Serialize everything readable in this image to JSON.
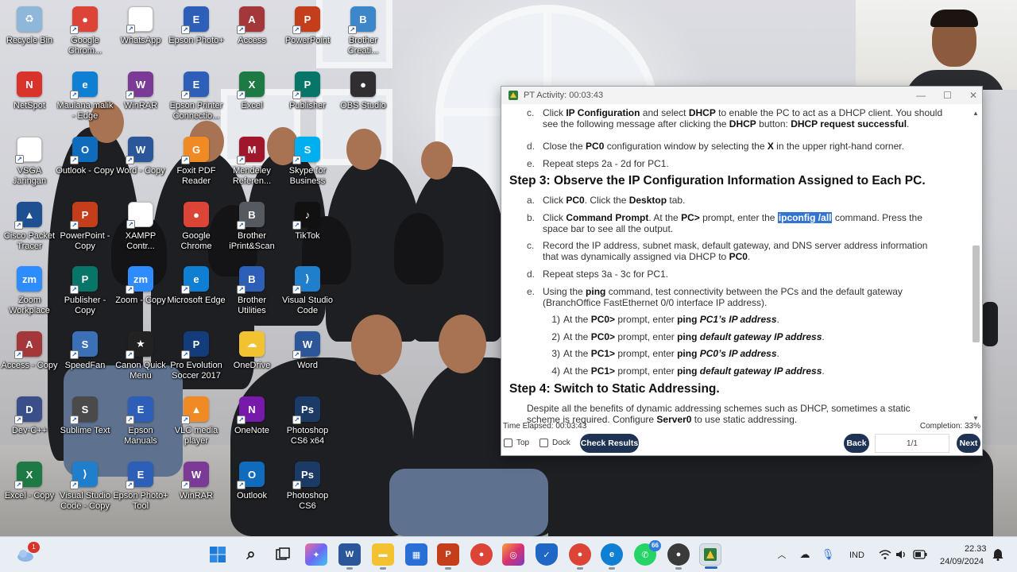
{
  "desktop_icons": [
    {
      "label": "Recycle Bin",
      "color": "#8fb7d9",
      "glyph": "♻",
      "shortcut": false
    },
    {
      "label": "Google Chrom...",
      "color": "#db4437",
      "glyph": "●",
      "shortcut": true
    },
    {
      "label": "WhatsApp",
      "color": "#ffffff",
      "glyph": "",
      "shortcut": true
    },
    {
      "label": "Epson Photo+",
      "color": "#2d5fb8",
      "glyph": "E",
      "shortcut": true
    },
    {
      "label": "Access",
      "color": "#a4373a",
      "glyph": "A",
      "shortcut": true
    },
    {
      "label": "PowerPoint",
      "color": "#c43e1c",
      "glyph": "P",
      "shortcut": true
    },
    {
      "label": "Brother Creati...",
      "color": "#3d86c9",
      "glyph": "B",
      "shortcut": true
    },
    {
      "label": "NetSpot",
      "color": "#d9342b",
      "glyph": "N",
      "shortcut": false
    },
    {
      "label": "Maulana malik - Edge",
      "color": "#0f7fd4",
      "glyph": "e",
      "shortcut": true
    },
    {
      "label": "WinRAR",
      "color": "#7b3a96",
      "glyph": "W",
      "shortcut": true
    },
    {
      "label": "Epson Printer Connectio...",
      "color": "#2d5fb8",
      "glyph": "E",
      "shortcut": true
    },
    {
      "label": "Excel",
      "color": "#1d7a45",
      "glyph": "X",
      "shortcut": true
    },
    {
      "label": "Publisher",
      "color": "#077568",
      "glyph": "P",
      "shortcut": true
    },
    {
      "label": "OBS Studio",
      "color": "#302e31",
      "glyph": "●",
      "shortcut": false
    },
    {
      "label": "VSGA Jaringan",
      "color": "#ffffff",
      "glyph": "",
      "shortcut": true
    },
    {
      "label": "Outlook - Copy",
      "color": "#0f6cbd",
      "glyph": "O",
      "shortcut": true
    },
    {
      "label": "Word - Copy",
      "color": "#2b579a",
      "glyph": "W",
      "shortcut": true
    },
    {
      "label": "Foxit PDF Reader",
      "color": "#f08a24",
      "glyph": "G",
      "shortcut": true
    },
    {
      "label": "Mendeley Referen...",
      "color": "#a0172b",
      "glyph": "M",
      "shortcut": true
    },
    {
      "label": "Skype for Business",
      "color": "#00aff0",
      "glyph": "S",
      "shortcut": true
    },
    {
      "label": "Cisco Packet Tracer",
      "color": "#1d4f91",
      "glyph": "▲",
      "shortcut": true
    },
    {
      "label": "PowerPoint - Copy",
      "color": "#c43e1c",
      "glyph": "P",
      "shortcut": true
    },
    {
      "label": "XAMPP Contr...",
      "color": "#ffffff",
      "glyph": "",
      "shortcut": true
    },
    {
      "label": "Google Chrome",
      "color": "#db4437",
      "glyph": "●",
      "shortcut": false
    },
    {
      "label": "Brother iPrint&Scan",
      "color": "#555a61",
      "glyph": "B",
      "shortcut": true
    },
    {
      "label": "TikTok",
      "color": "#111111",
      "glyph": "♪",
      "shortcut": true
    },
    {
      "label": "Publisher - Copy",
      "color": "#077568",
      "glyph": "P",
      "shortcut": true
    },
    {
      "label": "Zoom - Copy",
      "color": "#2d8cff",
      "glyph": "zm",
      "shortcut": true
    },
    {
      "label": "Microsoft Edge",
      "color": "#0f7fd4",
      "glyph": "e",
      "shortcut": true
    },
    {
      "label": "Brother Utilities",
      "color": "#2d5fb8",
      "glyph": "B",
      "shortcut": true
    },
    {
      "label": "Visual Studio Code",
      "color": "#1f7fcc",
      "glyph": "⟩",
      "shortcut": true
    },
    {
      "label": "Zoom Workplace",
      "color": "#2d8cff",
      "glyph": "zm",
      "shortcut": false
    },
    {
      "label": "Access - Copy",
      "color": "#a4373a",
      "glyph": "A",
      "shortcut": true
    },
    {
      "label": "SpeedFan",
      "color": "#3b6fb6",
      "glyph": "S",
      "shortcut": true
    },
    {
      "label": "Canon Quick Menu",
      "color": "#222222",
      "glyph": "★",
      "shortcut": true
    },
    {
      "label": "Pro Evolution Soccer 2017",
      "color": "#123c7a",
      "glyph": "P",
      "shortcut": true
    },
    {
      "label": "OneDrive",
      "color": "#f2c230",
      "glyph": "☁",
      "shortcut": false
    },
    {
      "label": "Word",
      "color": "#2b579a",
      "glyph": "W",
      "shortcut": true
    },
    {
      "label": "Dev-C++",
      "color": "#3a4f8a",
      "glyph": "D",
      "shortcut": true
    },
    {
      "label": "Sublime Text",
      "color": "#4a4a4a",
      "glyph": "S",
      "shortcut": true
    },
    {
      "label": "Epson Manuals",
      "color": "#2d5fb8",
      "glyph": "E",
      "shortcut": true
    },
    {
      "label": "VLC media player",
      "color": "#f08a24",
      "glyph": "▲",
      "shortcut": true
    },
    {
      "label": "OneNote",
      "color": "#7719aa",
      "glyph": "N",
      "shortcut": true
    },
    {
      "label": "Photoshop CS6 x64",
      "color": "#1b3a66",
      "glyph": "Ps",
      "shortcut": true
    },
    {
      "label": "Excel - Copy",
      "color": "#1d7a45",
      "glyph": "X",
      "shortcut": true
    },
    {
      "label": "Visual Studio Code - Copy",
      "color": "#1f7fcc",
      "glyph": "⟩",
      "shortcut": true
    },
    {
      "label": "Epson Photo+ Tool",
      "color": "#2d5fb8",
      "glyph": "E",
      "shortcut": true
    },
    {
      "label": "WinRAR",
      "color": "#7b3a96",
      "glyph": "W",
      "shortcut": true
    },
    {
      "label": "Outlook",
      "color": "#0f6cbd",
      "glyph": "O",
      "shortcut": true
    },
    {
      "label": "Photoshop CS6",
      "color": "#1b3a66",
      "glyph": "Ps",
      "shortcut": true
    }
  ],
  "pt_window": {
    "title": "PT Activity: 00:03:43",
    "step2": {
      "c": {
        "letter": "c.",
        "t1": "Click ",
        "b1": "IP Configuration",
        "t2": " and select ",
        "b2": "DHCP",
        "t3": " to enable the PC to act as a DHCP client. You should",
        "t4": "see the following message after clicking the ",
        "b3": "DHCP",
        "t5": " button: ",
        "b4": "DHCP request successful",
        "t6": "."
      },
      "d": {
        "letter": "d.",
        "t1": "Close the ",
        "b1": "PC0",
        "t2": " configuration window by selecting the ",
        "b2": "X",
        "t3": " in the upper right-hand corner."
      },
      "e": {
        "letter": "e.",
        "t1": "Repeat steps 2a - 2d for PC1."
      }
    },
    "step3_heading": "Step 3: Observe the IP Configuration Information Assigned to Each PC.",
    "step3": {
      "a": {
        "letter": "a.",
        "t1": "Click ",
        "b1": "PC0",
        "t2": ". Click the ",
        "b2": "Desktop",
        "t3": " tab."
      },
      "b": {
        "letter": "b.",
        "t1": "Click ",
        "b1": "Command Prompt",
        "t2": ". At the ",
        "b2": "PC>",
        "t3": " prompt, enter the ",
        "hl": "ipconfig /all",
        "t4": " command. Press the",
        "t5": "space bar to see all the output."
      },
      "c": {
        "letter": "c.",
        "t1": "Record the IP address, subnet mask, default gateway, and DNS server address information",
        "t2": "that was dynamically assigned via DHCP to ",
        "b1": "PC0",
        "t3": "."
      },
      "d": {
        "letter": "d.",
        "t1": "Repeat steps 3a - 3c for PC1."
      },
      "e": {
        "letter": "e.",
        "t1": "Using the ",
        "b1": "ping",
        "t2": " command, test connectivity between the PCs and the default gateway",
        "t3": "(BranchOffice FastEthernet 0/0 interface IP address)."
      },
      "sub": [
        {
          "n": "1)",
          "t1": "At the ",
          "b1": "PC0>",
          "t2": " prompt, enter ",
          "b2": "ping ",
          "bi": "PC1’s IP address",
          "t3": "."
        },
        {
          "n": "2)",
          "t1": "At the ",
          "b1": "PC0>",
          "t2": " prompt, enter ",
          "b2": "ping ",
          "bi": "default gateway IP address",
          "t3": "."
        },
        {
          "n": "3)",
          "t1": "At the ",
          "b1": "PC1>",
          "t2": " prompt, enter ",
          "b2": "ping ",
          "bi": "PC0’s IP address",
          "t3": "."
        },
        {
          "n": "4)",
          "t1": "At the ",
          "b1": "PC1>",
          "t2": " prompt, enter ",
          "b2": "ping ",
          "bi": "default gateway IP address",
          "t3": "."
        }
      ]
    },
    "step4_heading": "Step 4: Switch to Static Addressing.",
    "step4_para": {
      "t1": "Despite all the benefits of dynamic addressing schemes such as DHCP, sometimes a static",
      "t2": "scheme is required. Configure ",
      "b1": "Server0",
      "t3": " to use static addressing."
    },
    "time_elapsed": "Time Elapsed: 00:03:43",
    "completion": "Completion: 33%",
    "top_label": "Top",
    "dock_label": "Dock",
    "check_results_label": "Check Results",
    "back_label": "Back",
    "page_indicator": "1/1",
    "next_label": "Next"
  },
  "taskbar": {
    "weather_badge": "1",
    "whatsapp_badge": "66",
    "language": "IND",
    "time": "22.33",
    "date": "24/09/2024"
  },
  "colors": {
    "accent": "#1e3354",
    "highlight": "#3474d1"
  }
}
